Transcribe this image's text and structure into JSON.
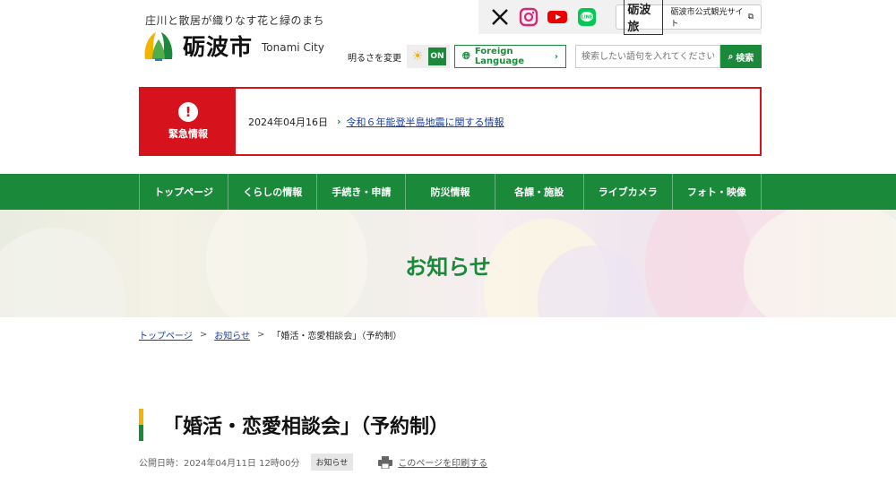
{
  "header": {
    "tagline": "庄川と散居が織りなす花と緑のまち",
    "logo_name": "砺波市",
    "logo_en": "Tonami City",
    "brightness_label": "明るさを変更",
    "brightness_state": "ON",
    "foreign_language": "Foreign Language",
    "search_placeholder": "検索したい語句を入れてください",
    "search_button": "検索"
  },
  "social": {
    "icons": [
      "x-icon",
      "instagram-icon",
      "youtube-icon",
      "line-icon"
    ],
    "line_label": "LINE",
    "tour_logo": "砺波旅",
    "tour_text": "砺波市公式観光サイト"
  },
  "emergency": {
    "title": "緊急情報",
    "date": "2024年04月16日",
    "link": "令和６年能登半島地震に関する情報"
  },
  "nav": {
    "items": [
      "トップページ",
      "くらしの情報",
      "手続き・申請",
      "防災情報",
      "各課・施設",
      "ライブカメラ",
      "フォト・映像"
    ]
  },
  "hero": {
    "title": "お知らせ"
  },
  "breadcrumb": {
    "home": "トップページ",
    "section": "お知らせ",
    "current": "「婚活・恋愛相談会」（予約制）"
  },
  "article": {
    "title": "「婚活・恋愛相談会」（予約制）",
    "published": "公開日時：2024年04月11日 12時00分",
    "category": "お知らせ",
    "print": "このページを印刷する"
  },
  "colors": {
    "brand_green": "#1a8a3a",
    "alert_red": "#d6121c",
    "accent_yellow": "#f2b400",
    "link_blue": "#1a3fa0"
  }
}
